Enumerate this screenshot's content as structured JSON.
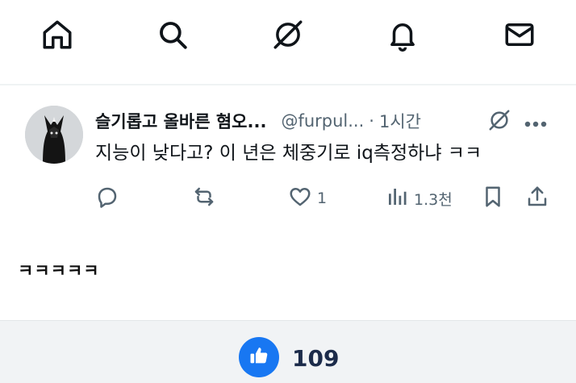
{
  "nav": {
    "items": [
      {
        "icon": "home-icon"
      },
      {
        "icon": "search-icon"
      },
      {
        "icon": "grok-icon"
      },
      {
        "icon": "bell-icon"
      },
      {
        "icon": "mail-icon"
      }
    ]
  },
  "tweet": {
    "display_name": "슬기롭고 올바른 혐오...",
    "handle": "@furpul...",
    "separator": "·",
    "time": "1시간",
    "text": "지능이 낮다고? 이 년은 체중기로 iq측정하냐 ㅋㅋ",
    "actions": {
      "reply_count": "",
      "retweet_count": "",
      "like_count": "1",
      "views_count": "1.3천"
    }
  },
  "comment": {
    "text": "ㅋㅋㅋㅋㅋ"
  },
  "bottom_bar": {
    "like_count": "109",
    "accent_color": "#1877f2"
  }
}
